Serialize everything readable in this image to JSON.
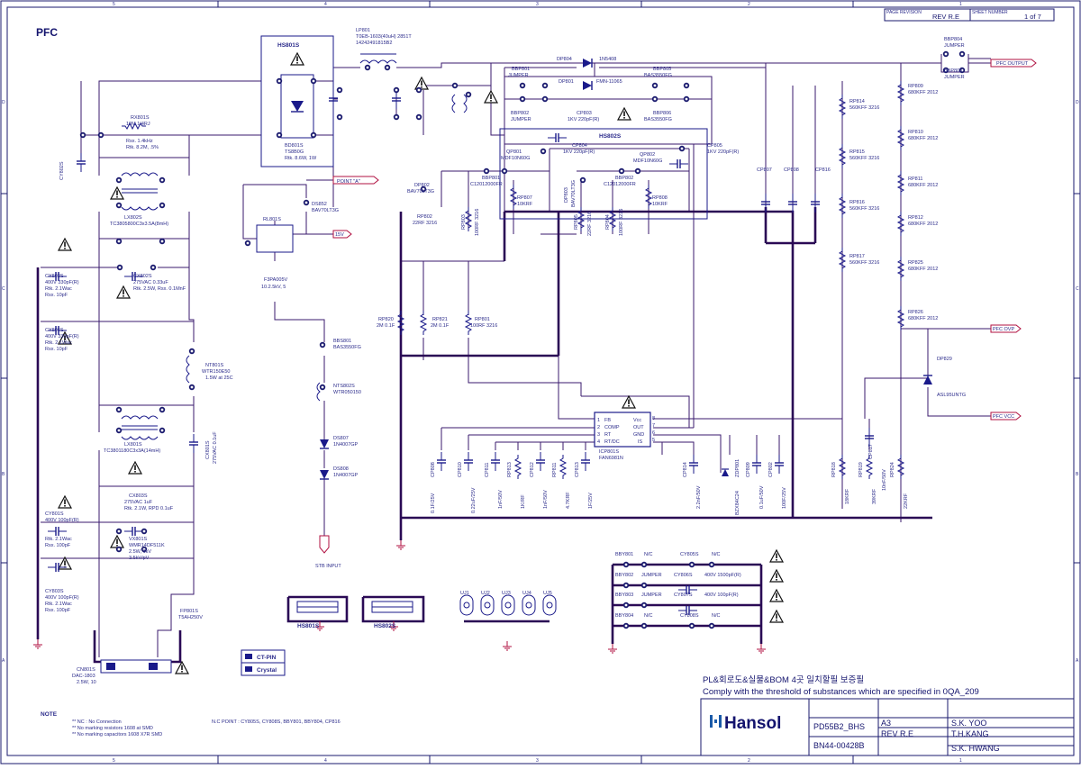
{
  "sheet": {
    "title": "PFC",
    "page_revision_label": "PAGE REVISION",
    "rev": "REV R.E",
    "sheet_number_label": "SHEET NUMBER",
    "sheet_number": "1 of 7",
    "col_markers": [
      "5",
      "4",
      "3",
      "2",
      "1"
    ],
    "row_markers": [
      "D",
      "C",
      "B",
      "A"
    ]
  },
  "labels": {
    "hs801s": "HS801S",
    "hs802s": "HS802S",
    "lp801": "LP801",
    "lp801_detail": "T0EB-1603(40uH) 2851T",
    "lp801_detail2": "14242491815B2",
    "bd801s": "BD801S",
    "bd801s_part": "TS8B0G",
    "bd801s_rating": "Rtk. 8.6W, 1W",
    "dp801": "DP801",
    "dp801_part": "FMN-11065",
    "dp804": "DP804",
    "dp804_part": "1N5408",
    "bbp801": "BBP801",
    "bbp801_val": "JUMPER",
    "bbp802": "BBP802",
    "bbp802_val": "JUMPER",
    "bbp803": "BBP803",
    "bbp803_val": "JUMPER",
    "bbp804": "BBP804",
    "bbp804_val": "JUMPER",
    "bbp805": "BBP805",
    "bbp805_val": "BAS3550FG",
    "bbp806": "BBP806",
    "bbp806_val": "BAS3550FG",
    "cp803": "CP803",
    "cp803_val": "1KV 220pF(R)",
    "cp804": "CP804",
    "cp804_val": "1KV 220pF(R)",
    "cp805": "CP805",
    "cp805_val": "1KV 220pF(R)",
    "qp801": "QP801",
    "qp801_part": "MDF10N60G",
    "qp802": "QP802",
    "qp802_part": "MDF10N60G",
    "dp802": "DP802",
    "dp802_part": "BAV70LT3G",
    "dp803": "DP803",
    "dp803_part": "BAV70LT3G",
    "bbp801b": "BBP801",
    "bbp801b_part": "C12012000FR",
    "bbp802b": "BBP802",
    "bbp802b_part": "C12012000FR",
    "rp807": "RP807",
    "rp807_val": "10KRF",
    "rp808": "RP808",
    "rp808_val": "10KRF",
    "rp802": "RP802",
    "rp802_val": "22RF 3216",
    "rp803": "RP803",
    "rp803_val": "100RF 3216",
    "rp804": "RP804",
    "rp804_val": "100RF 3216",
    "rp805": "RP805",
    "rp805_val": "22RF 3216",
    "rx801s": "RX801S",
    "rx801s_val": "10M 1/4RJ",
    "rx801s_note1": "Rsx. 1.4kHz",
    "rx801s_note2": "Rtk. 8.2M, .5%",
    "cx801s_left": "CX801S",
    "cx801s_left_val": "275VAC 0.1uF",
    "lx802s": "LX802S",
    "lx802s_val": "TC3805800C3x3.5A(8mH)",
    "lx801s": "LX801S",
    "lx801s_val": "TC3801180C3x3A(14mH)",
    "cy802s": "CY802S",
    "cy802s_val": "400V 330pF(R)",
    "cy802s_n1": "Rtk. 2.1Wac",
    "cy802s_n2": "Rsx. 10pF",
    "cy804s": "CY804S",
    "cy804s_val": "400V 330pF(R)",
    "cy804s_n1": "Rtk. 2.1Wac",
    "cy804s_n2": "Rsx. 10pF",
    "cy801s": "CY801S",
    "cy801s_val": "400V 100pF(R)",
    "cy801s_n1": "Rtk. 2.1Wac",
    "cy801s_n2": "Rsx. 100pF",
    "cy803s": "CY803S",
    "cy803s_val": "400V 100pF(R)",
    "cy803s_n1": "Rtk. 2.1Wac",
    "cy803s_n2": "Rsx. 100pF",
    "cx802s": "CX802S",
    "cx802s_val": "275VAC 0.33uF",
    "cx802s_n": "Rtk. 2.5W, Rsx. 0.1MnF",
    "cx803s": "CX803S",
    "cx803s_val": "275VAC 1uF",
    "cx803s_n": "Rtk. 2.1W, RPD 0.1uF",
    "nt801s": "NT801S",
    "nt801s_val": "WTR150E50",
    "nt801s_n": "1.5W at 25C",
    "vx801s": "VX801S",
    "vx801s_val": "WMR14DF511K",
    "vx801s_n1": "2.5W, 1kV",
    "vx801s_n2": "3.5kV/pV",
    "fp801s": "FP801S",
    "fp801s_val": "T5AH250V",
    "cn801s": "CN801S",
    "cn801s_val": "DAC-1803",
    "cn801s_n": "2.5W, 10",
    "rl801s": "RL801S",
    "rl801s_val": "F3PA005V",
    "rl801s_n": "10.2.5kV, 5",
    "ds852": "DS852",
    "ds852_val": "BAV70LT3G",
    "point_a": "POINT \"A\"",
    "v15": "15V",
    "bbs801": "BBS801",
    "bbs801_val": "BAS3550FG",
    "nts802s": "NTS802S",
    "nts802s_val": "WTR050150",
    "ds807": "DS807",
    "ds807_val": "1N4007GP",
    "ds808": "DS808",
    "ds808_val": "1N4007GP",
    "stb_input": "STB INPUT",
    "rp820": "RP820",
    "rp820_val": "2M 0.1F",
    "rp821": "RP821",
    "rp821_val": "2M 0.1F",
    "rp801": "RP801",
    "rp801_val": "100RF 3216",
    "bbp801_block": "BBP801",
    "bbp801_block_val": "BAS3550FG",
    "icp801s": "ICP801S",
    "icp801s_part": "FAN6981N",
    "ic_pins_left": [
      "FB",
      "COMP",
      "RT",
      "RT/DC"
    ],
    "ic_pins_right": [
      "Vcc",
      "OUT",
      "GND",
      "IS"
    ],
    "ic_pin_nums_left": [
      "1",
      "2",
      "3",
      "4"
    ],
    "ic_pin_nums_right": [
      "8",
      "7",
      "6",
      "5"
    ],
    "pfc_output": "PFC OUTPUT",
    "pfc_ovp": "PFC OVP",
    "pfc_vcc": "PFC VCC",
    "bbp804_top": "BBP804",
    "bbp804_top_val": "JUMPER",
    "bbp803_top": "BBP803",
    "bbp803_top_val": "JUMPER",
    "rp814": "RP814",
    "rp814_val": "560KFF 3216",
    "rp815": "RP815",
    "rp815_val": "560KFF 3216",
    "rp816": "RP816",
    "rp816_val": "560KFF 3216",
    "rp817": "RP817",
    "rp817_val": "560KFF 3216",
    "rp809": "RP809",
    "rp809_val": "680KFF 2012",
    "rp810": "RP810",
    "rp810_val": "680KFF 2012",
    "rp811": "RP811",
    "rp811_val": "680KFF 2012",
    "rp812": "RP812",
    "rp812_val": "680KFF 2012",
    "rp825": "RP825",
    "rp825_val": "680KFF 2012",
    "rp826": "RP826",
    "rp826_val": "680KFF 2012",
    "dp829": "DP829",
    "dp829_val": "ASL95UNTG",
    "cp807": "CP807",
    "cp808": "CP808",
    "cp816": "CP816",
    "bottom_caps": [
      "CP808",
      "CP810",
      "RP813",
      "CP811",
      "RP811",
      "CP812",
      "RP812",
      "CP813",
      "CP814",
      "CP815",
      "ZDP801",
      "CP809",
      "CP802",
      "RP818",
      "RP819",
      "CP817",
      "RP824"
    ],
    "bottom_cap_vals": [
      "0.1F/25V",
      "0.22uF/25V",
      "1K/RF",
      "1nF/50V",
      "4.7KRF",
      "1nF/50V",
      "1F/25V",
      "2.2nF/50V",
      "1uF/50V",
      "2.2uF/50V",
      "BZX84C24",
      "0.1uF/50V",
      "100F/25V",
      "18KRF",
      "39KRF",
      "10nF/50V",
      "22KRF"
    ],
    "bbv_rows": [
      {
        "ref": "BBY801",
        "val": "N/C",
        "cy": "CY805S",
        "cyval": "N/C"
      },
      {
        "ref": "BBY802",
        "val": "JUMPER",
        "cy": "CY806S",
        "cyval": "400V 1500pF(R)"
      },
      {
        "ref": "BBY803",
        "val": "JUMPER",
        "cy": "CY807S",
        "cyval": "400V 100pF(R)"
      },
      {
        "ref": "BBY804",
        "val": "N/C",
        "cy": "CY808S",
        "cyval": "N/C"
      }
    ],
    "uj_labels": [
      "UJ1",
      "UJ2",
      "UJ3",
      "UJ4",
      "UJ5"
    ],
    "hs801s_bottom": "HS801S",
    "hs802s_bottom": "HS802S",
    "ct_pin": "CT-PIN",
    "crystal": "Crystal",
    "nc_point": "N.C POINT : CY805S, CY808S, BBY801, BBY804, CP816",
    "note_label": "NOTE",
    "notes": [
      "** NC : No Connection",
      "** No marking resistors 1608 at SMD",
      "** No marking capacitors 1608 X7R SMD"
    ]
  },
  "title_block": {
    "korean_note": "PL&회로도&실물&BOM 4곳 일치할필 보증필",
    "threshold_note": "Comply with the threshold of substances which are specified in 0QA_209",
    "brand": "Hansol",
    "model": "PD55B2_BHS",
    "part_number": "BN44-00428B",
    "size": "A3",
    "revision": "REV R.E",
    "people": [
      "S.K. YOO",
      "T.H.KANG",
      "S.K. HWANG"
    ]
  },
  "colors": {
    "wire": "#3a1a6e",
    "bus": "#2a0a55",
    "component": "#1a1a8a",
    "border": "#1a1a6e",
    "brand_blue": "#1a5aa8",
    "background": "#ffffff"
  }
}
